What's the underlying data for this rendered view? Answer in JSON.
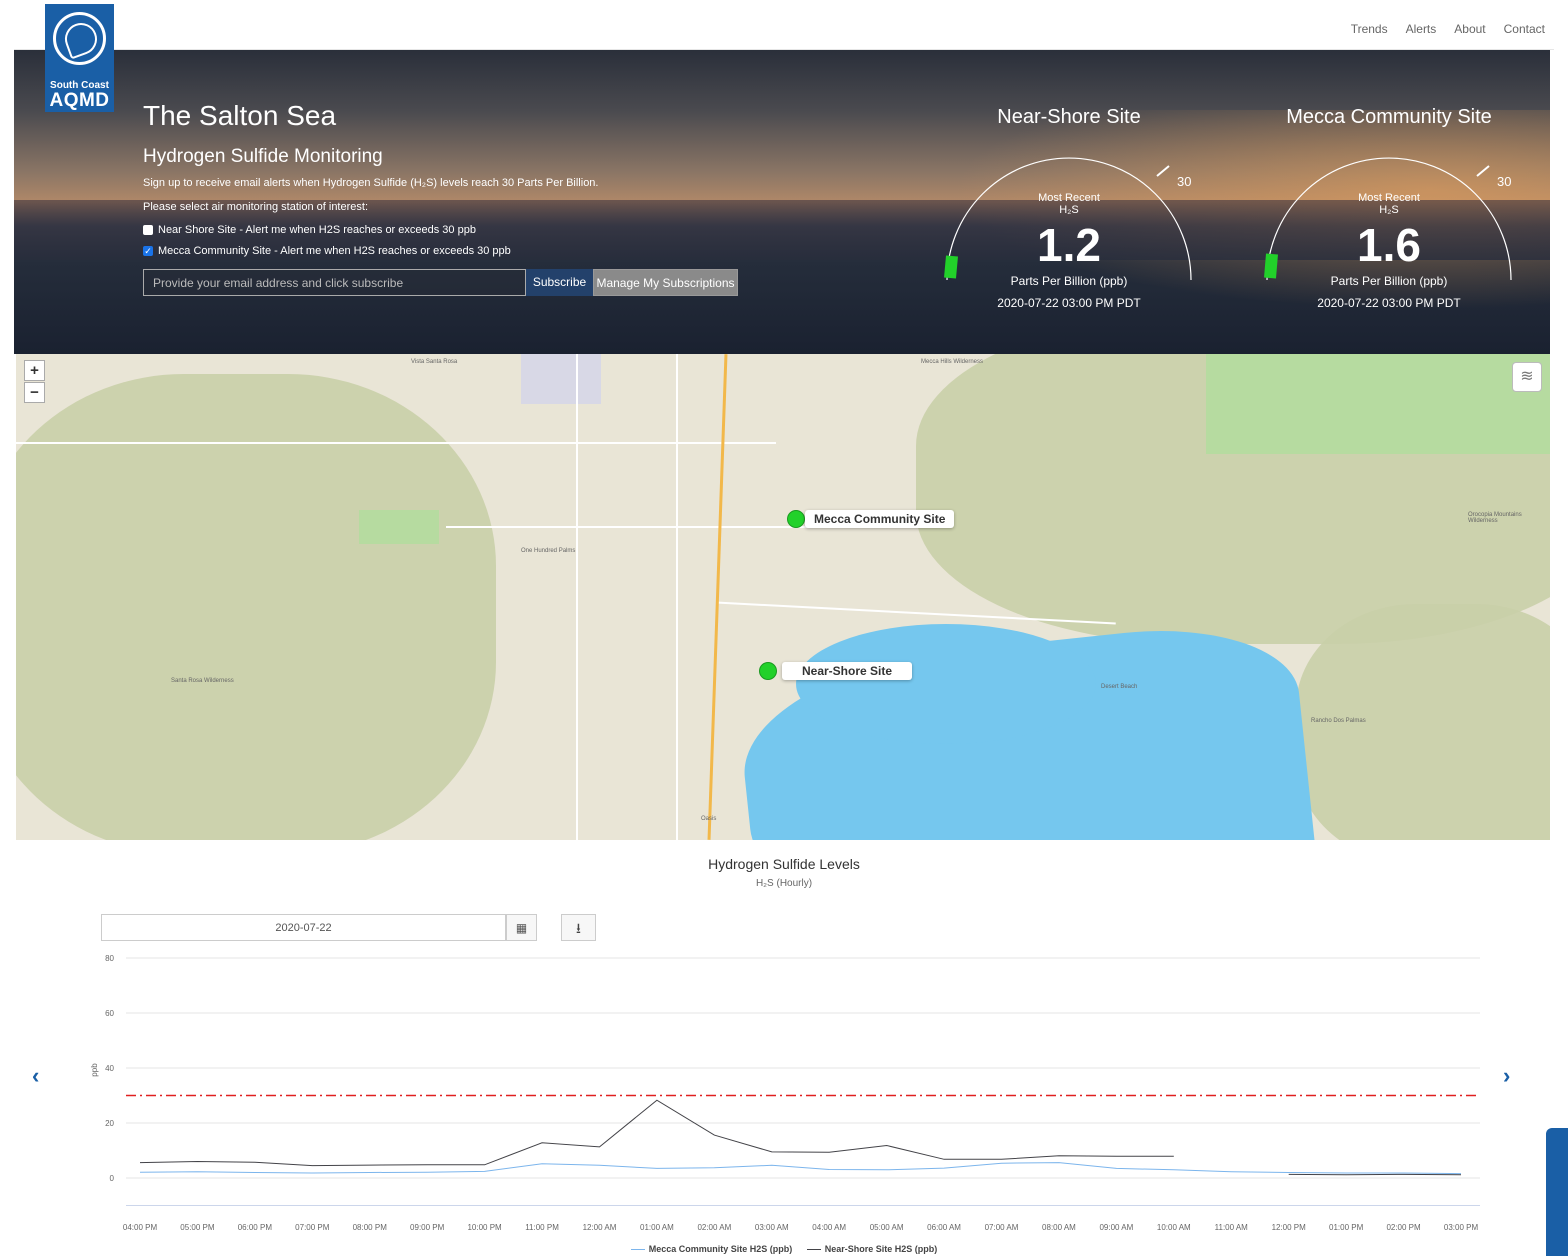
{
  "nav": {
    "links": [
      "Trends",
      "Alerts",
      "About",
      "Contact"
    ]
  },
  "logo": {
    "line1": "South Coast",
    "line2": "AQMD"
  },
  "hero": {
    "title": "The Salton Sea",
    "subtitle": "Hydrogen Sulfide Monitoring",
    "description": "Sign up to receive email alerts when Hydrogen Sulfide (H₂S) levels reach 30 Parts Per Billion.",
    "select_prompt": "Please select air monitoring station of interest:",
    "options": [
      {
        "label": "Near Shore Site - Alert me when H2S reaches or exceeds 30 ppb",
        "checked": false
      },
      {
        "label": "Mecca Community Site - Alert me when H2S reaches or exceeds 30 ppb",
        "checked": true
      }
    ],
    "email_placeholder": "Provide your email address and click subscribe",
    "subscribe_label": "Subscribe",
    "manage_label": "Manage My Subscriptions"
  },
  "gauges": [
    {
      "title": "Near-Shore Site",
      "most_recent": "Most Recent",
      "species": "H₂S",
      "value": "1.2",
      "unit": "Parts Per Billion (ppb)",
      "timestamp": "2020-07-22 03:00 PM PDT",
      "threshold": "30",
      "fill_fraction": 0.04
    },
    {
      "title": "Mecca Community Site",
      "most_recent": "Most Recent",
      "species": "H₂S",
      "value": "1.6",
      "unit": "Parts Per Billion (ppb)",
      "timestamp": "2020-07-22 03:00 PM PDT",
      "threshold": "30",
      "fill_fraction": 0.05
    }
  ],
  "map": {
    "zoom_in": "+",
    "zoom_out": "−",
    "markers": [
      {
        "label": "Mecca Community Site"
      },
      {
        "label": "Near-Shore Site"
      }
    ]
  },
  "chart": {
    "title": "Hydrogen Sulfide Levels",
    "subtitle": "H₂S (Hourly)",
    "date_value": "2020-07-22",
    "prev_label": "‹",
    "next_label": "›"
  },
  "chart_data": {
    "type": "line",
    "title": "Hydrogen Sulfide Levels",
    "subtitle": "H₂S (Hourly)",
    "xlabel": "",
    "ylabel": "ppb",
    "ylim": [
      -10,
      80
    ],
    "yticks": [
      0,
      20,
      40,
      60,
      80
    ],
    "categories": [
      "04:00 PM",
      "05:00 PM",
      "06:00 PM",
      "07:00 PM",
      "08:00 PM",
      "09:00 PM",
      "10:00 PM",
      "11:00 PM",
      "12:00 AM",
      "01:00 AM",
      "02:00 AM",
      "03:00 AM",
      "04:00 AM",
      "05:00 AM",
      "06:00 AM",
      "07:00 AM",
      "08:00 AM",
      "09:00 AM",
      "10:00 AM",
      "11:00 AM",
      "12:00 PM",
      "01:00 PM",
      "02:00 PM",
      "03:00 PM"
    ],
    "threshold": 30,
    "series": [
      {
        "name": "Mecca Community Site H2S (ppb)",
        "color": "#7cb5ec",
        "values": [
          2.1,
          2.3,
          2.0,
          1.8,
          2.0,
          2.1,
          2.4,
          5.2,
          4.6,
          3.5,
          3.7,
          4.6,
          3.1,
          3.0,
          3.6,
          5.4,
          5.6,
          3.5,
          3.0,
          2.3,
          2.0,
          1.8,
          1.8,
          1.6
        ]
      },
      {
        "name": "Near-Shore Site H2S (ppb)",
        "color": "#434348",
        "values": [
          5.6,
          6.0,
          5.7,
          4.5,
          4.7,
          4.8,
          4.8,
          12.8,
          11.3,
          28.3,
          15.6,
          9.5,
          9.4,
          11.8,
          6.8,
          6.8,
          8.1,
          7.9,
          7.9,
          null,
          1.3,
          1.2,
          1.3,
          1.2
        ]
      }
    ],
    "legend_position": "bottom",
    "grid": true
  }
}
